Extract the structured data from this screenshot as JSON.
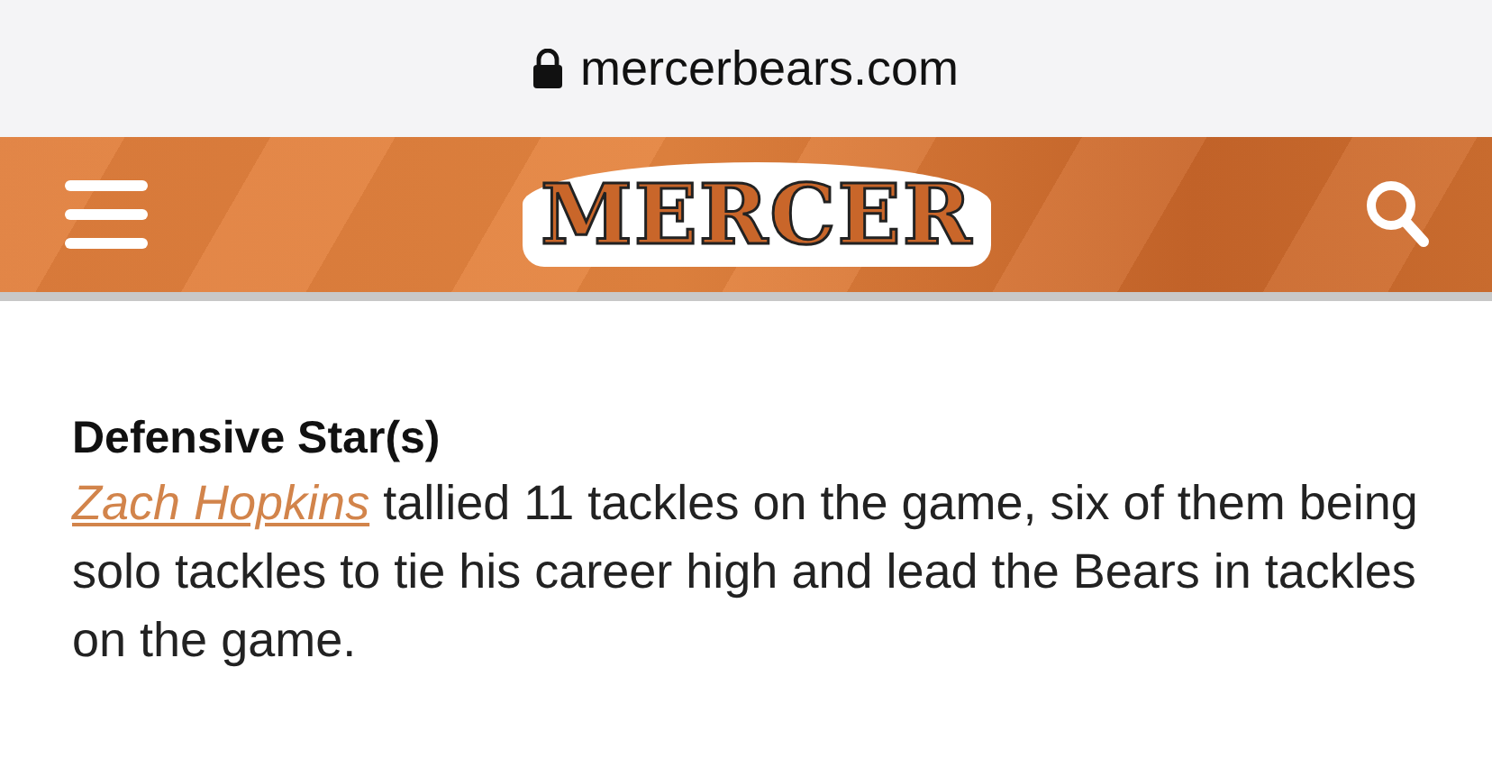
{
  "browser": {
    "url": "mercerbears.com",
    "secure": true
  },
  "header": {
    "logo": "MERCER"
  },
  "article": {
    "heading": "Defensive Star(s)",
    "link": "Zach Hopkins",
    "text": " tallied 11 tackles on the game, six of them being solo tackles to tie his career high and lead the Bears in tackles on the game."
  }
}
